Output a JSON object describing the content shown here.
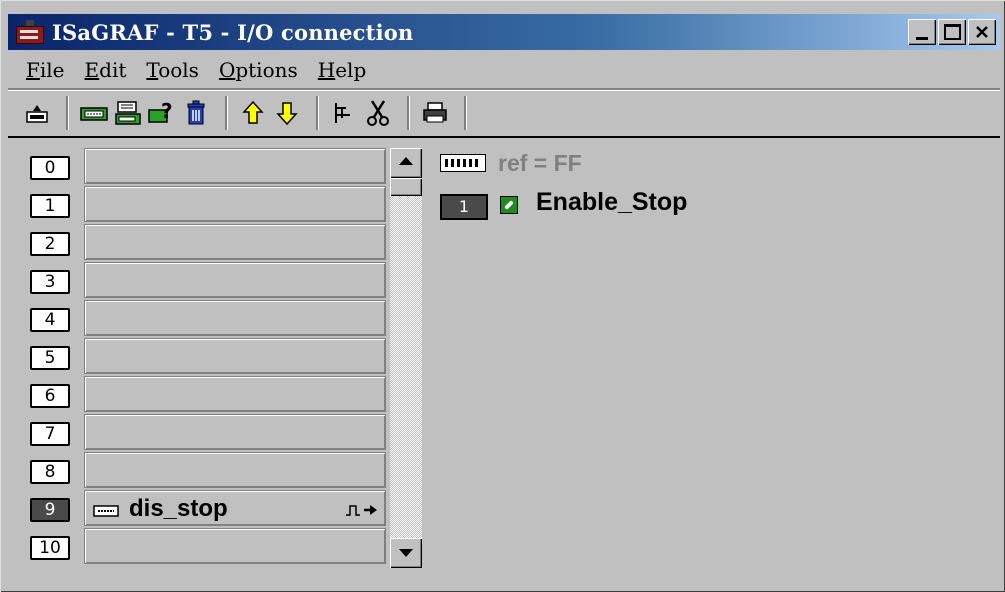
{
  "window": {
    "title": "ISaGRAF - T5 - I/O connection",
    "caption_buttons": [
      "minimize",
      "maximize",
      "close"
    ]
  },
  "menu": [
    {
      "label": "File",
      "mnemonic": "F",
      "rest": "ile"
    },
    {
      "label": "Edit",
      "mnemonic": "E",
      "rest": "dit"
    },
    {
      "label": "Tools",
      "mnemonic": "T",
      "rest": "ools"
    },
    {
      "label": "Options",
      "mnemonic": "O",
      "rest": "ptions"
    },
    {
      "label": "Help",
      "mnemonic": "H",
      "rest": "elp"
    }
  ],
  "toolbar": [
    {
      "icon": "open-board-icon"
    },
    {
      "icon": "set-board-icon"
    },
    {
      "icon": "board-params-icon"
    },
    {
      "icon": "board-help-icon"
    },
    {
      "icon": "delete-icon"
    },
    {
      "icon": "move-up-icon"
    },
    {
      "icon": "move-down-icon"
    },
    {
      "icon": "connect-icon"
    },
    {
      "icon": "cut-icon"
    },
    {
      "icon": "print-icon"
    }
  ],
  "slots": [
    {
      "num": "0",
      "board": ""
    },
    {
      "num": "1",
      "board": ""
    },
    {
      "num": "2",
      "board": ""
    },
    {
      "num": "3",
      "board": ""
    },
    {
      "num": "4",
      "board": ""
    },
    {
      "num": "5",
      "board": ""
    },
    {
      "num": "6",
      "board": ""
    },
    {
      "num": "7",
      "board": ""
    },
    {
      "num": "8",
      "board": ""
    },
    {
      "num": "9",
      "board": "dis_stop",
      "selected": true
    },
    {
      "num": "10",
      "board": ""
    }
  ],
  "detail": {
    "ref": "ref = FF",
    "channel_num": "1",
    "channel_variable": "Enable_Stop"
  },
  "colors": {
    "title_gradient_start": "#0a246a",
    "title_gradient_end": "#a6caf0",
    "face": "#c0c0c0",
    "selected_slot": "#4a4a4a",
    "ref_text": "#808080"
  }
}
